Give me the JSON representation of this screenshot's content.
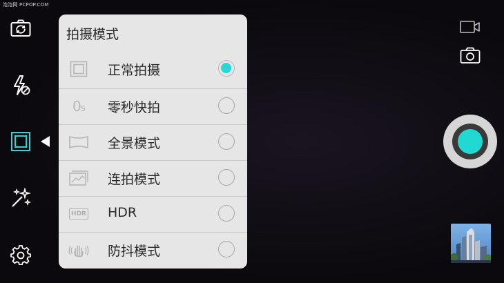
{
  "watermark": "泡泡网 PCPOP.COM",
  "left_toolbar": {
    "items": [
      {
        "name": "switch-camera",
        "icon": "camera-switch-icon"
      },
      {
        "name": "flash",
        "icon": "flash-off-icon"
      },
      {
        "name": "mode",
        "icon": "mode-frame-icon",
        "active": true
      },
      {
        "name": "filters",
        "icon": "magic-wand-icon"
      },
      {
        "name": "settings",
        "icon": "gear-icon"
      }
    ]
  },
  "mode_panel": {
    "title": "拍摄模式",
    "modes": [
      {
        "label": "正常拍摄",
        "icon": "frame-icon",
        "selected": true
      },
      {
        "label": "零秒快拍",
        "icon": "zero-seconds-icon",
        "icon_text": "0",
        "icon_sub": "s",
        "selected": false
      },
      {
        "label": "全景模式",
        "icon": "panorama-icon",
        "selected": false
      },
      {
        "label": "连拍模式",
        "icon": "burst-icon",
        "selected": false
      },
      {
        "label": "HDR",
        "icon": "hdr-icon",
        "icon_text": "HDR",
        "selected": false
      },
      {
        "label": "防抖模式",
        "icon": "stabilize-hand-icon",
        "selected": false
      }
    ]
  },
  "right_controls": {
    "video_mode": "video-camera-icon",
    "photo_mode": "camera-icon",
    "shutter": "shutter-button",
    "gallery": "last-photo-thumbnail"
  },
  "colors": {
    "accent": "#2ad6d6",
    "panel_bg": "#e6e6e6",
    "viewfinder_bg": "#0e0b10"
  }
}
